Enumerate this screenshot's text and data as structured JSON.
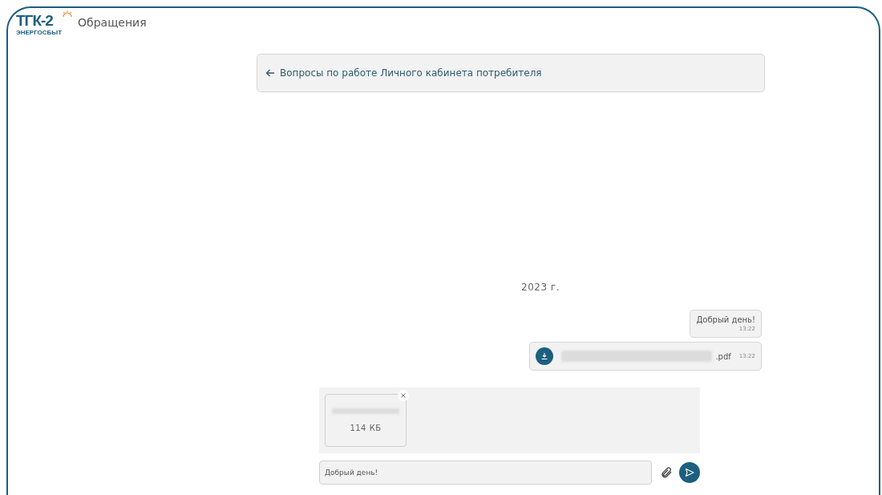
{
  "header": {
    "logo": {
      "name": "ТГК-2",
      "subtitle": "ЭНЕРГОСБЫТ"
    },
    "title": "Обращения"
  },
  "topic": {
    "title": "Вопросы по работе Личного кабинета потребителя"
  },
  "chat": {
    "date": "2023 г.",
    "messages": [
      {
        "kind": "text",
        "text": "Добрый день!",
        "time": "13:22"
      },
      {
        "kind": "file",
        "extension": ".pdf",
        "time": "13:22"
      }
    ]
  },
  "attachments": [
    {
      "size": "114 КБ"
    }
  ],
  "composer": {
    "value": "Добрый день!"
  }
}
